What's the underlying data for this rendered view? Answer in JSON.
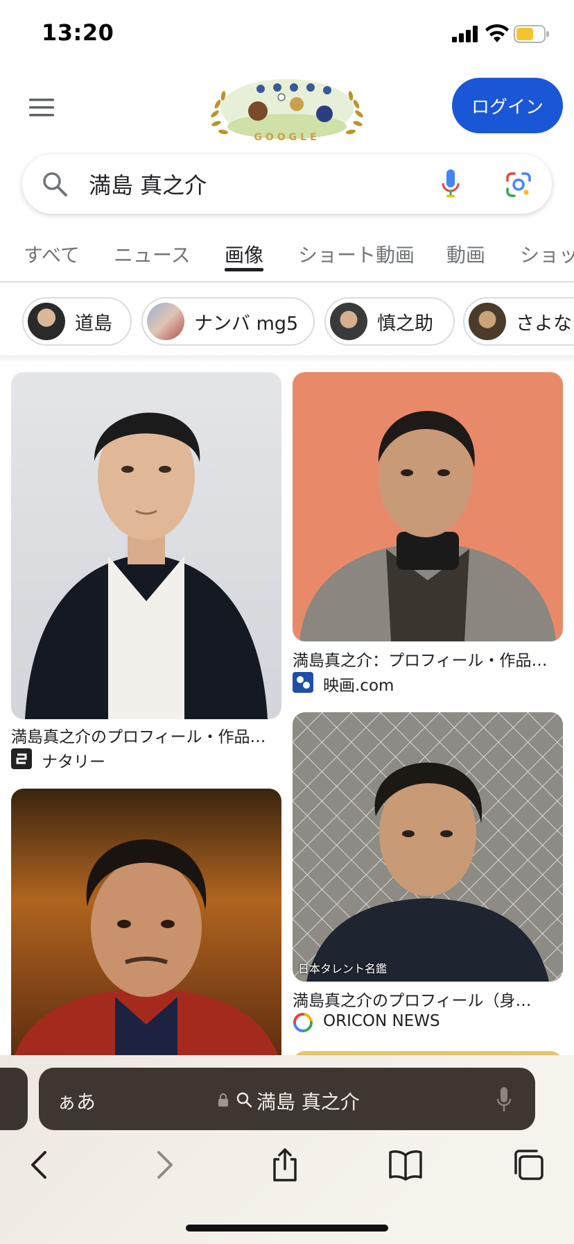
{
  "status_bar": {
    "time": "13:20"
  },
  "header": {
    "login_label": "ログイン"
  },
  "search": {
    "query": "満島 真之介"
  },
  "tabs": [
    {
      "label": "すべて",
      "active": false
    },
    {
      "label": "ニュース",
      "active": false
    },
    {
      "label": "画像",
      "active": true
    },
    {
      "label": "ショート動画",
      "active": false
    },
    {
      "label": "動画",
      "active": false
    },
    {
      "label": "ショッ",
      "active": false
    }
  ],
  "chips": [
    {
      "label": "道島"
    },
    {
      "label": "ナンバ mg5"
    },
    {
      "label": "慎之助"
    },
    {
      "label": "さよな"
    }
  ],
  "results": [
    {
      "caption": "満島真之介のプロフィール・作品…",
      "source": "ナタリー"
    },
    {
      "caption": "満島真之介：プロフィール・作品…",
      "source": "映画.com"
    },
    {
      "caption": "",
      "source": ""
    },
    {
      "caption": "満島真之介のプロフィール（身…",
      "source": "ORICON NEWS"
    }
  ],
  "image_overlays": {
    "oricon_watermark": "日本タレント名鑑"
  },
  "browser": {
    "text_size_label": "ぁあ",
    "url_display": "満島 真之介"
  },
  "colors": {
    "accent_blue": "#1a57d6",
    "url_bar": "#3e3630",
    "tab_active": "#202124",
    "tab_inactive": "#70757a"
  }
}
